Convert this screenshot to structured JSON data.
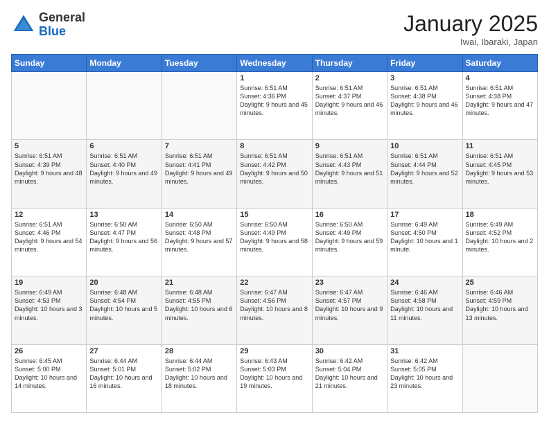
{
  "logo": {
    "text_general": "General",
    "text_blue": "Blue"
  },
  "header": {
    "month_title": "January 2025",
    "location": "Iwai, Ibaraki, Japan"
  },
  "weekdays": [
    "Sunday",
    "Monday",
    "Tuesday",
    "Wednesday",
    "Thursday",
    "Friday",
    "Saturday"
  ],
  "weeks": [
    [
      {
        "day": "",
        "info": ""
      },
      {
        "day": "",
        "info": ""
      },
      {
        "day": "",
        "info": ""
      },
      {
        "day": "1",
        "info": "Sunrise: 6:51 AM\nSunset: 4:36 PM\nDaylight: 9 hours and 45 minutes."
      },
      {
        "day": "2",
        "info": "Sunrise: 6:51 AM\nSunset: 4:37 PM\nDaylight: 9 hours and 46 minutes."
      },
      {
        "day": "3",
        "info": "Sunrise: 6:51 AM\nSunset: 4:38 PM\nDaylight: 9 hours and 46 minutes."
      },
      {
        "day": "4",
        "info": "Sunrise: 6:51 AM\nSunset: 4:38 PM\nDaylight: 9 hours and 47 minutes."
      }
    ],
    [
      {
        "day": "5",
        "info": "Sunrise: 6:51 AM\nSunset: 4:39 PM\nDaylight: 9 hours and 48 minutes."
      },
      {
        "day": "6",
        "info": "Sunrise: 6:51 AM\nSunset: 4:40 PM\nDaylight: 9 hours and 49 minutes."
      },
      {
        "day": "7",
        "info": "Sunrise: 6:51 AM\nSunset: 4:41 PM\nDaylight: 9 hours and 49 minutes."
      },
      {
        "day": "8",
        "info": "Sunrise: 6:51 AM\nSunset: 4:42 PM\nDaylight: 9 hours and 50 minutes."
      },
      {
        "day": "9",
        "info": "Sunrise: 6:51 AM\nSunset: 4:43 PM\nDaylight: 9 hours and 51 minutes."
      },
      {
        "day": "10",
        "info": "Sunrise: 6:51 AM\nSunset: 4:44 PM\nDaylight: 9 hours and 52 minutes."
      },
      {
        "day": "11",
        "info": "Sunrise: 6:51 AM\nSunset: 4:45 PM\nDaylight: 9 hours and 53 minutes."
      }
    ],
    [
      {
        "day": "12",
        "info": "Sunrise: 6:51 AM\nSunset: 4:46 PM\nDaylight: 9 hours and 54 minutes."
      },
      {
        "day": "13",
        "info": "Sunrise: 6:50 AM\nSunset: 4:47 PM\nDaylight: 9 hours and 56 minutes."
      },
      {
        "day": "14",
        "info": "Sunrise: 6:50 AM\nSunset: 4:48 PM\nDaylight: 9 hours and 57 minutes."
      },
      {
        "day": "15",
        "info": "Sunrise: 6:50 AM\nSunset: 4:49 PM\nDaylight: 9 hours and 58 minutes."
      },
      {
        "day": "16",
        "info": "Sunrise: 6:50 AM\nSunset: 4:49 PM\nDaylight: 9 hours and 59 minutes."
      },
      {
        "day": "17",
        "info": "Sunrise: 6:49 AM\nSunset: 4:50 PM\nDaylight: 10 hours and 1 minute."
      },
      {
        "day": "18",
        "info": "Sunrise: 6:49 AM\nSunset: 4:52 PM\nDaylight: 10 hours and 2 minutes."
      }
    ],
    [
      {
        "day": "19",
        "info": "Sunrise: 6:49 AM\nSunset: 4:53 PM\nDaylight: 10 hours and 3 minutes."
      },
      {
        "day": "20",
        "info": "Sunrise: 6:48 AM\nSunset: 4:54 PM\nDaylight: 10 hours and 5 minutes."
      },
      {
        "day": "21",
        "info": "Sunrise: 6:48 AM\nSunset: 4:55 PM\nDaylight: 10 hours and 6 minutes."
      },
      {
        "day": "22",
        "info": "Sunrise: 6:47 AM\nSunset: 4:56 PM\nDaylight: 10 hours and 8 minutes."
      },
      {
        "day": "23",
        "info": "Sunrise: 6:47 AM\nSunset: 4:57 PM\nDaylight: 10 hours and 9 minutes."
      },
      {
        "day": "24",
        "info": "Sunrise: 6:46 AM\nSunset: 4:58 PM\nDaylight: 10 hours and 11 minutes."
      },
      {
        "day": "25",
        "info": "Sunrise: 6:46 AM\nSunset: 4:59 PM\nDaylight: 10 hours and 13 minutes."
      }
    ],
    [
      {
        "day": "26",
        "info": "Sunrise: 6:45 AM\nSunset: 5:00 PM\nDaylight: 10 hours and 14 minutes."
      },
      {
        "day": "27",
        "info": "Sunrise: 6:44 AM\nSunset: 5:01 PM\nDaylight: 10 hours and 16 minutes."
      },
      {
        "day": "28",
        "info": "Sunrise: 6:44 AM\nSunset: 5:02 PM\nDaylight: 10 hours and 18 minutes."
      },
      {
        "day": "29",
        "info": "Sunrise: 6:43 AM\nSunset: 5:03 PM\nDaylight: 10 hours and 19 minutes."
      },
      {
        "day": "30",
        "info": "Sunrise: 6:42 AM\nSunset: 5:04 PM\nDaylight: 10 hours and 21 minutes."
      },
      {
        "day": "31",
        "info": "Sunrise: 6:42 AM\nSunset: 5:05 PM\nDaylight: 10 hours and 23 minutes."
      },
      {
        "day": "",
        "info": ""
      }
    ]
  ]
}
